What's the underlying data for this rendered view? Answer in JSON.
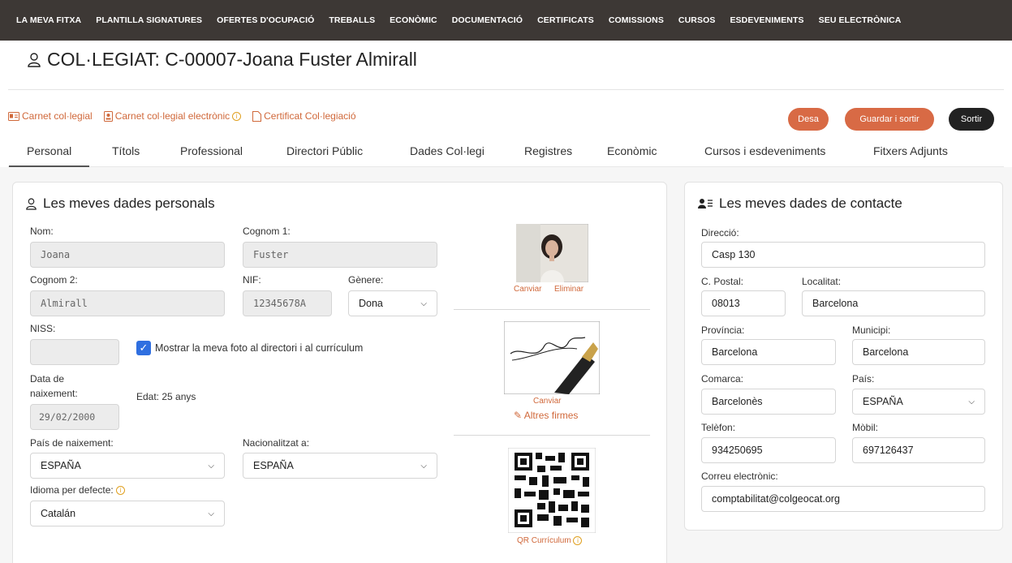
{
  "nav": [
    "LA MEVA FITXA",
    "PLANTILLA SIGNATURES",
    "OFERTES D'OCUPACIÓ",
    "TREBALLS",
    "ECONÒMIC",
    "DOCUMENTACIÓ",
    "CERTIFICATS",
    "COMISSIONS",
    "CURSOS",
    "ESDEVENIMENTS",
    "SEU ELECTRÒNICA"
  ],
  "title": "COL·LEGIAT: C-00007-Joana Fuster Almirall",
  "links": {
    "carnet": "Carnet col·legial",
    "carnet_electronic": "Carnet col·legial electrònic",
    "certificat": "Certificat Col·legiació"
  },
  "buttons": {
    "desa": "Desa",
    "guardar": "Guardar i sortir",
    "sortir": "Sortir"
  },
  "tabs": [
    "Personal",
    "Títols",
    "Professional",
    "Directori Públic",
    "Dades Col·legi",
    "Registres",
    "Econòmic",
    "Cursos i esdeveniments",
    "Fitxers Adjunts"
  ],
  "personal": {
    "title": "Les meves dades personals",
    "nom_label": "Nom:",
    "nom": "Joana",
    "cognom1_label": "Cognom 1:",
    "cognom1": "Fuster",
    "cognom2_label": "Cognom 2:",
    "cognom2": "Almirall",
    "nif_label": "NIF:",
    "nif": "12345678A",
    "genere_label": "Gènere:",
    "genere": "Dona",
    "niss_label": "NISS:",
    "niss": "",
    "mostrar_foto": "Mostrar la meva foto al directori i al currículum",
    "data_label_1": "Data de",
    "data_label_2": "naixement:",
    "data_naixement": "29/02/2000",
    "edat": "Edat: 25 anys",
    "pais_label": "País de naixement:",
    "pais": "ESPAÑA",
    "nacionalitat_label": "Nacionalitzat a:",
    "nacionalitat": "ESPAÑA",
    "idioma_label": "Idioma per defecte:",
    "idioma": "Catalán",
    "photo_change": "Canviar",
    "photo_delete": "Eliminar",
    "signature_change": "Canviar",
    "altres_firmes": "Altres firmes",
    "qr_label": "QR Currículum"
  },
  "contact": {
    "title": "Les meves dades de contacte",
    "direccio_label": "Direcció:",
    "direccio": "Casp 130",
    "cp_label": "C. Postal:",
    "cp": "08013",
    "localitat_label": "Localitat:",
    "localitat": "Barcelona",
    "provincia_label": "Província:",
    "provincia": "Barcelona",
    "municipi_label": "Municipi:",
    "municipi": "Barcelona",
    "comarca_label": "Comarca:",
    "comarca": "Barcelonès",
    "pais_label": "País:",
    "pais": "ESPAÑA",
    "telefon_label": "Telèfon:",
    "telefon": "934250695",
    "mobil_label": "Mòbil:",
    "mobil": "697126437",
    "correu_label": "Correu electrònic:",
    "correu": "comptabilitat@colgeocat.org"
  },
  "colors": {
    "accent": "#d86a45",
    "nav_bg": "#3d3835",
    "checkbox": "#2f6fe0"
  }
}
